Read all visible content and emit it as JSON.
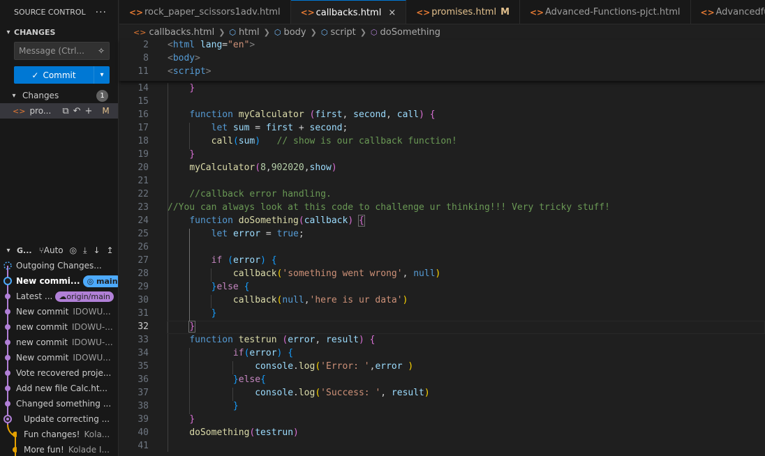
{
  "sidebar": {
    "title": "SOURCE CONTROL",
    "more": "···",
    "section": "CHANGES",
    "message_placeholder": "Message (Ctrl...",
    "commit_label": "Commit",
    "changes_label": "Changes",
    "changes_count": "1",
    "file": {
      "name": "pro...",
      "status": "M"
    }
  },
  "graph": {
    "title": "G...",
    "auto": "Auto",
    "rows": [
      {
        "text": "Outgoing Changes...",
        "author": ""
      },
      {
        "text": "New commi...",
        "tag": "main",
        "author": ""
      },
      {
        "text": "Latest ...",
        "tag": "origin/main",
        "author": ""
      },
      {
        "text": "New commit",
        "author": "IDOWU..."
      },
      {
        "text": "new commit",
        "author": "IDOWU-..."
      },
      {
        "text": "new commit",
        "author": "IDOWU-..."
      },
      {
        "text": "New commit",
        "author": "IDOWU..."
      },
      {
        "text": "Vote recovered proje...",
        "author": ""
      },
      {
        "text": "Add new file Calc.ht...",
        "author": ""
      },
      {
        "text": "Changed something ...",
        "author": ""
      },
      {
        "text": "Update correcting ...",
        "author": ""
      },
      {
        "text": "Fun changes!",
        "author": "Kola..."
      },
      {
        "text": "More fun!",
        "author": "Kolade I..."
      }
    ]
  },
  "tabs": [
    {
      "label": "rock_paper_scissors1adv.html"
    },
    {
      "label": "callbacks.html",
      "close": "×"
    },
    {
      "label": "promises.html",
      "flag": "M"
    },
    {
      "label": "Advanced-Functions-pjct.html"
    },
    {
      "label": "Advancedfunct-tim"
    }
  ],
  "breadcrumb": [
    "callbacks.html",
    "html",
    "body",
    "script",
    "doSomething"
  ],
  "editor": {
    "sticky_lines": [
      "2",
      "8",
      "11"
    ],
    "lines": [
      "14",
      "15",
      "16",
      "17",
      "18",
      "19",
      "20",
      "21",
      "22",
      "23",
      "24",
      "25",
      "26",
      "27",
      "28",
      "29",
      "30",
      "31",
      "32",
      "33",
      "34",
      "35",
      "36",
      "37",
      "38",
      "39",
      "40",
      "41"
    ],
    "current_line": "32"
  },
  "colors": {
    "accent": "#0078d4",
    "modified": "#e2c08d",
    "graph_main": "#b180d7",
    "graph_branch": "#e5a100"
  }
}
